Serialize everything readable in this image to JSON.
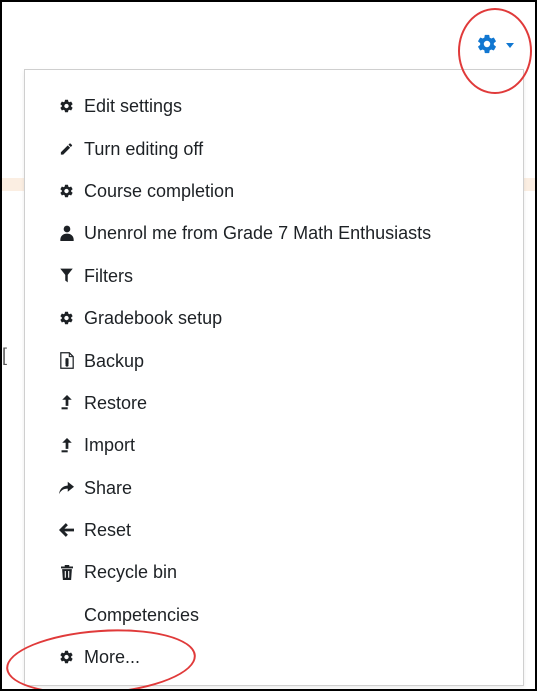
{
  "colors": {
    "accent": "#1177d1",
    "annotation_ring": "#e03a3a",
    "menu_text": "#1d2125",
    "background_strip": "#fbeee2"
  },
  "trigger": {
    "icon": "gear-icon",
    "caret_icon": "caret-down-icon"
  },
  "background": {
    "partial_glyph": "["
  },
  "menu": {
    "items": [
      {
        "label": "Edit settings",
        "icon": "cog-icon"
      },
      {
        "label": "Turn editing off",
        "icon": "pencil-icon"
      },
      {
        "label": "Course completion",
        "icon": "cog-icon"
      },
      {
        "label": "Unenrol me from Grade 7 Math Enthusiasts",
        "icon": "user-icon"
      },
      {
        "label": "Filters",
        "icon": "filter-icon"
      },
      {
        "label": "Gradebook setup",
        "icon": "cog-icon"
      },
      {
        "label": "Backup",
        "icon": "backup-file-icon"
      },
      {
        "label": "Restore",
        "icon": "upload-icon"
      },
      {
        "label": "Import",
        "icon": "upload-icon"
      },
      {
        "label": "Share",
        "icon": "share-icon"
      },
      {
        "label": "Reset",
        "icon": "arrow-left-icon"
      },
      {
        "label": "Recycle bin",
        "icon": "trash-icon"
      },
      {
        "label": "Competencies",
        "icon": ""
      },
      {
        "label": "More...",
        "icon": "cog-icon"
      }
    ]
  }
}
